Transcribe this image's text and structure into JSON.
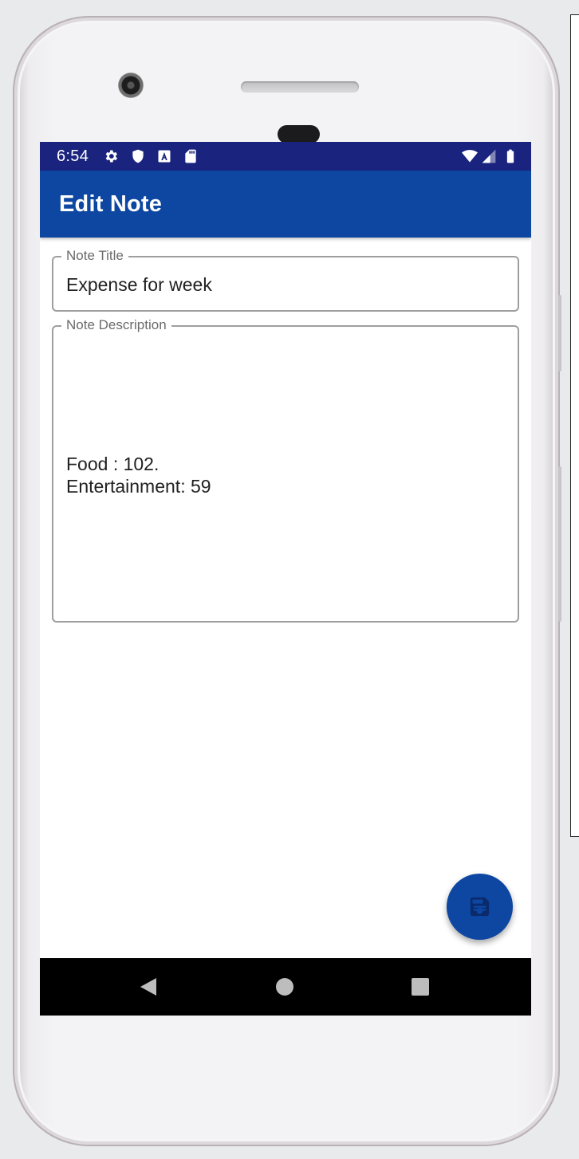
{
  "status_bar": {
    "time": "6:54",
    "left_icons": [
      "gear-icon",
      "shield-icon",
      "text-a-icon",
      "sd-card-icon"
    ],
    "right_icons": [
      "wifi-icon",
      "cell-signal-icon",
      "battery-icon"
    ]
  },
  "app_bar": {
    "title": "Edit Note"
  },
  "form": {
    "title_field": {
      "label": "Note Title",
      "value": "Expense for week"
    },
    "description_field": {
      "label": "Note Description",
      "value": "Food : 102.\nEntertainment: 59"
    }
  },
  "fab": {
    "icon": "save-icon"
  },
  "nav_bar": {
    "buttons": [
      "back-icon",
      "home-icon",
      "recents-icon"
    ]
  },
  "colors": {
    "status_bar": "#1a237e",
    "app_bar": "#0d47a1",
    "fab": "#0d47a1",
    "fab_icon": "#0a2a6b"
  }
}
